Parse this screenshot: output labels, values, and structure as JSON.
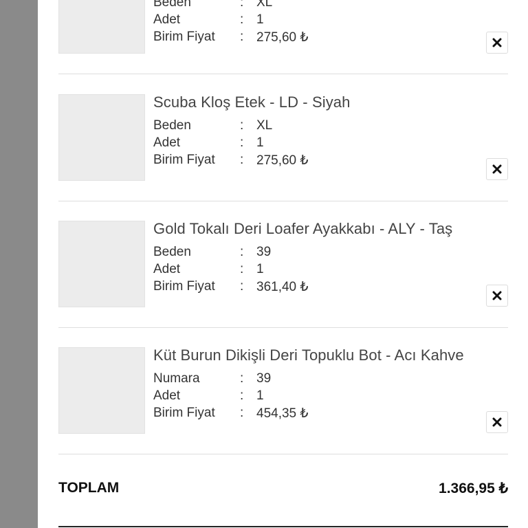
{
  "items": [
    {
      "title": "",
      "rows": [
        {
          "key": "Beden",
          "value": "XL"
        },
        {
          "key": "Adet",
          "value": "1"
        },
        {
          "key": "Birim Fiyat",
          "value": "275,60 ₺"
        }
      ]
    },
    {
      "title": "Scuba Kloş Etek - LD - Siyah",
      "rows": [
        {
          "key": "Beden",
          "value": "XL"
        },
        {
          "key": "Adet",
          "value": "1"
        },
        {
          "key": "Birim Fiyat",
          "value": "275,60 ₺"
        }
      ]
    },
    {
      "title": "Gold Tokalı Deri Loafer Ayakkabı - ALY - Taş",
      "rows": [
        {
          "key": "Beden",
          "value": "39"
        },
        {
          "key": "Adet",
          "value": "1"
        },
        {
          "key": "Birim Fiyat",
          "value": "361,40 ₺"
        }
      ]
    },
    {
      "title": "Küt Burun Dikişli Deri Topuklu Bot - Acı Kahve",
      "rows": [
        {
          "key": "Numara",
          "value": "39"
        },
        {
          "key": "Adet",
          "value": "1"
        },
        {
          "key": "Birim Fiyat",
          "value": "454,35 ₺"
        }
      ]
    }
  ],
  "separator": ":",
  "summary": {
    "total_label": "TOPLAM",
    "total_value": "1.366,95 ₺"
  },
  "icons": {
    "remove": "close-icon"
  },
  "colors": {
    "side_strip": "#8a8a8a",
    "divider": "#dedede"
  }
}
